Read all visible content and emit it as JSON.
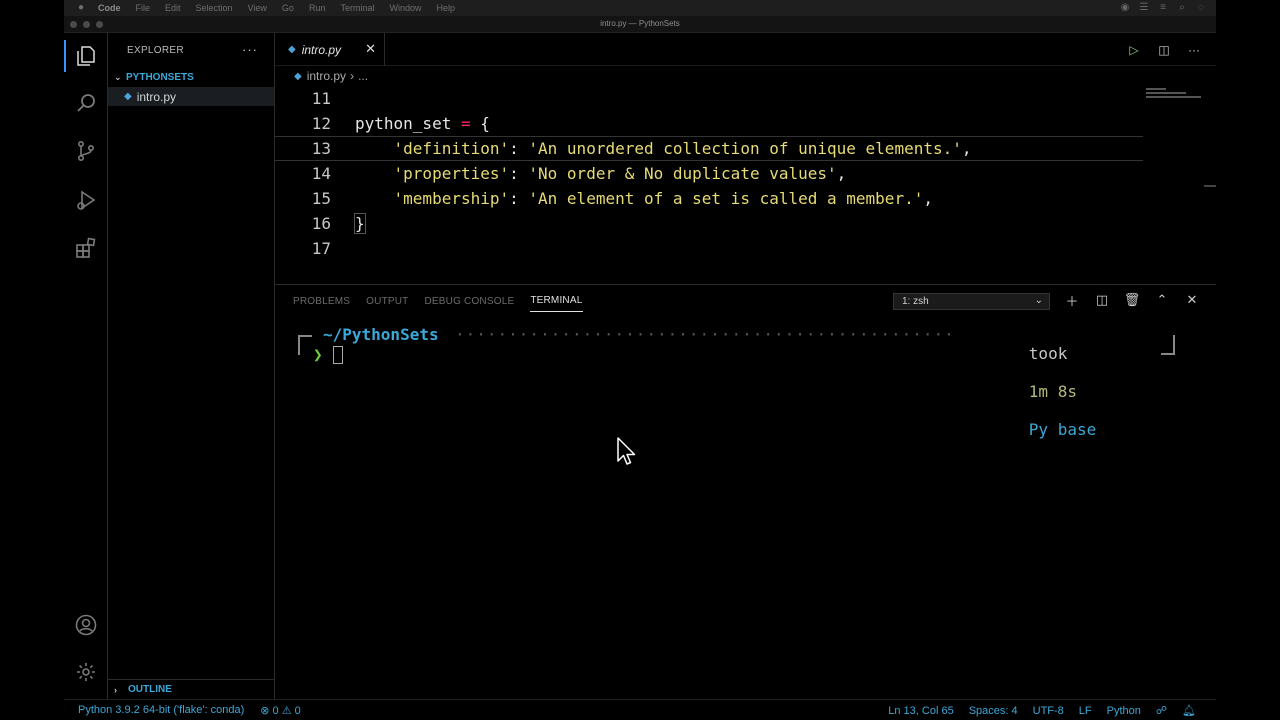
{
  "menubar": {
    "items": [
      "Code",
      "File",
      "Edit",
      "Selection",
      "View",
      "Go",
      "Run",
      "Terminal",
      "Window",
      "Help"
    ]
  },
  "window": {
    "title": "intro.py — PythonSets"
  },
  "sidebar": {
    "header": "EXPLORER",
    "folder": "PYTHONSETS",
    "file": "intro.py",
    "outline": "OUTLINE"
  },
  "editor": {
    "tab_label": "intro.py",
    "breadcrumb": {
      "file": "intro.py",
      "more": "..."
    },
    "lines": [
      {
        "num": "11",
        "parts": []
      },
      {
        "num": "12",
        "parts": [
          {
            "t": "python_set ",
            "c": "tok-var"
          },
          {
            "t": "=",
            "c": "tok-op"
          },
          {
            "t": " {",
            "c": "tok-punc"
          }
        ]
      },
      {
        "num": "13",
        "current": true,
        "parts": [
          {
            "t": "    ",
            "c": "tok-punc"
          },
          {
            "t": "'definition'",
            "c": "tok-str"
          },
          {
            "t": ": ",
            "c": "tok-punc"
          },
          {
            "t": "'An unordered collection of unique elements.'",
            "c": "tok-str"
          },
          {
            "t": ",",
            "c": "tok-punc"
          }
        ]
      },
      {
        "num": "14",
        "parts": [
          {
            "t": "    ",
            "c": "tok-punc"
          },
          {
            "t": "'properties'",
            "c": "tok-str"
          },
          {
            "t": ": ",
            "c": "tok-punc"
          },
          {
            "t": "'No order & No duplicate values'",
            "c": "tok-str"
          },
          {
            "t": ",",
            "c": "tok-punc"
          }
        ]
      },
      {
        "num": "15",
        "parts": [
          {
            "t": "    ",
            "c": "tok-punc"
          },
          {
            "t": "'membership'",
            "c": "tok-str"
          },
          {
            "t": ": ",
            "c": "tok-punc"
          },
          {
            "t": "'An element of a set is called a member.'",
            "c": "tok-str"
          },
          {
            "t": ",",
            "c": "tok-punc"
          }
        ]
      },
      {
        "num": "16",
        "parts": [
          {
            "t": "}",
            "c": "tok-punc"
          }
        ]
      },
      {
        "num": "17",
        "parts": []
      }
    ]
  },
  "panel": {
    "tabs": [
      "PROBLEMS",
      "OUTPUT",
      "DEBUG CONSOLE",
      "TERMINAL"
    ],
    "active_tab": "TERMINAL",
    "terminal_select": "1: zsh"
  },
  "terminal": {
    "path": "~/PythonSets",
    "took": "took",
    "duration": "1m 8s",
    "env": "Py base",
    "prompt": "❯"
  },
  "statusbar": {
    "interpreter": "Python 3.9.2 64-bit ('flake': conda)",
    "errors": "0",
    "warnings": "0",
    "position": "Ln 13, Col 65",
    "spaces": "Spaces: 4",
    "encoding": "UTF-8",
    "eol": "LF",
    "language": "Python"
  },
  "colors": {
    "accent": "#3ba8d8",
    "string": "#e6db74",
    "operator": "#f92672",
    "prompt": "#6bd03a"
  }
}
